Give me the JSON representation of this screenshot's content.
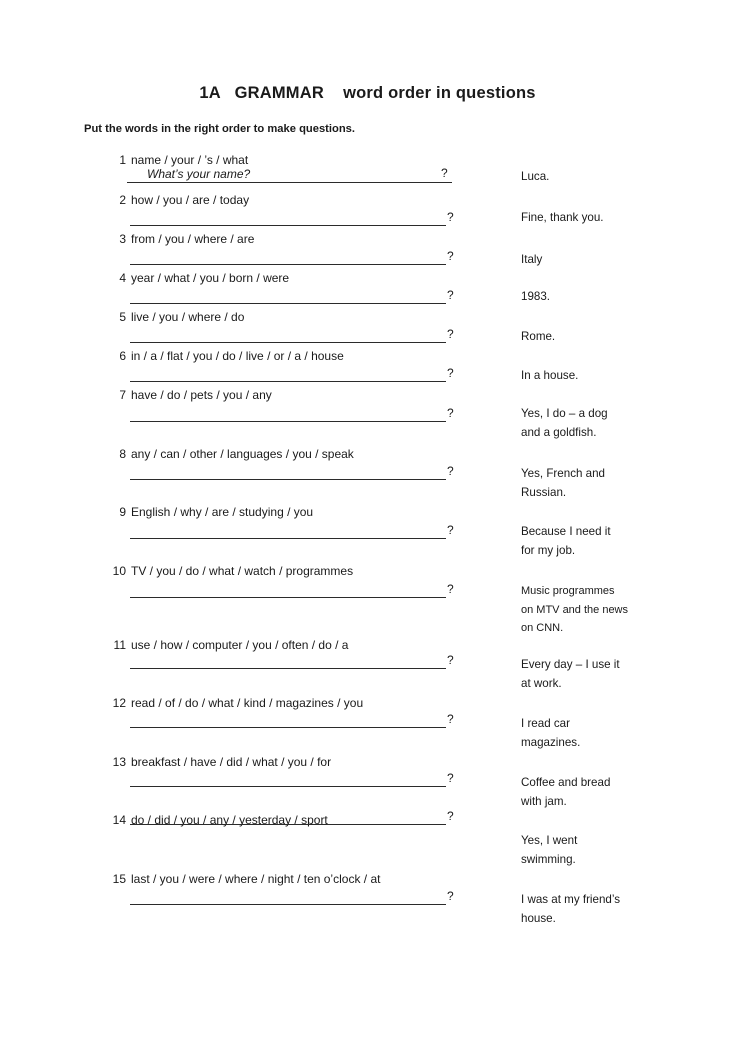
{
  "document": {
    "title": "1A   GRAMMAR    word order in questions",
    "instruction": "Put the words in the right order to make questions.",
    "question_mark": "?"
  },
  "exercise": {
    "items": [
      {
        "number": "1",
        "prompt": "name / your / ’s / what",
        "written_answer": "What’s your name?",
        "reply": "Luca."
      },
      {
        "number": "2",
        "prompt": "how / you / are / today",
        "written_answer": "",
        "reply": "Fine, thank you."
      },
      {
        "number": "3",
        "prompt": "from / you / where / are",
        "written_answer": "",
        "reply": "Italy"
      },
      {
        "number": "4",
        "prompt": "year / what / you / born / were",
        "written_answer": "",
        "reply": "1983."
      },
      {
        "number": "5",
        "prompt": "live / you / where / do",
        "written_answer": "",
        "reply": "Rome."
      },
      {
        "number": "6",
        "prompt": "in / a / flat / you / do / live / or / a / house",
        "written_answer": "",
        "reply": "In a house."
      },
      {
        "number": "7",
        "prompt": "have / do / pets / you / any",
        "written_answer": "",
        "reply": "Yes, I do – a dog\nand a goldfish."
      },
      {
        "number": "8",
        "prompt": "any / can / other / languages / you / speak",
        "written_answer": "",
        "reply": "Yes, French and\nRussian."
      },
      {
        "number": "9",
        "prompt": "English / why / are / studying / you",
        "written_answer": "",
        "reply": "Because I need it\nfor my job."
      },
      {
        "number": "10",
        "prompt": "TV / you / do / what / watch / programmes",
        "written_answer": "",
        "reply": "Music programmes\non MTV and the news\non CNN."
      },
      {
        "number": "11",
        "prompt": "use / how / computer / you / often / do / a",
        "written_answer": "",
        "reply": "Every day – I use it\nat work."
      },
      {
        "number": "12",
        "prompt": "read / of / do / what / kind / magazines / you",
        "written_answer": "",
        "reply": "I read car\nmagazines."
      },
      {
        "number": "13",
        "prompt": "breakfast / have / did / what / you / for",
        "written_answer": "",
        "reply": "Coffee and bread\nwith jam."
      },
      {
        "number": "14",
        "prompt": "do / did / you / any / yesterday / sport",
        "written_answer": "",
        "reply": "Yes, I went\nswimming."
      },
      {
        "number": "15",
        "prompt": "last / you / were / where / night / ten o’clock / at",
        "written_answer": "",
        "reply": "I was at my friend’s\nhouse."
      }
    ]
  }
}
